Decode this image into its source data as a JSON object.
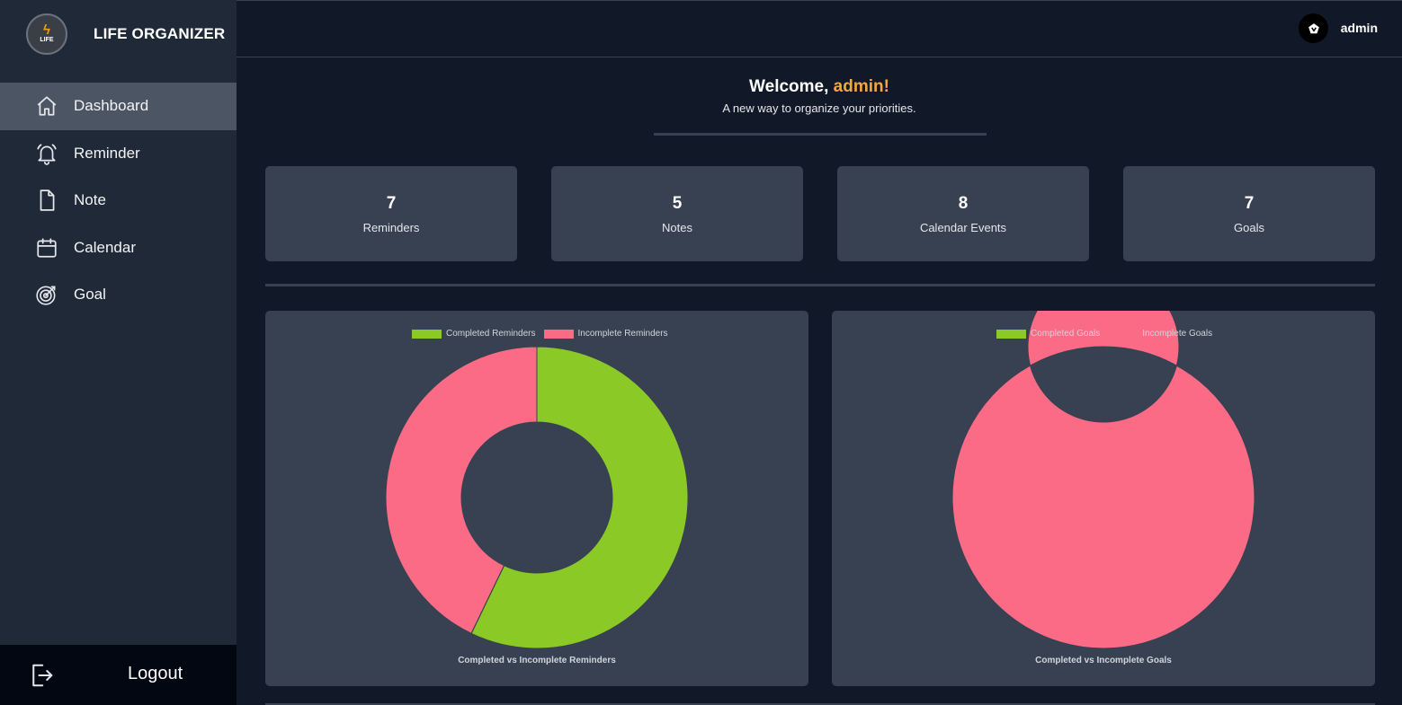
{
  "app": {
    "title": "LIFE ORGANIZER",
    "logo_text": "LIFE"
  },
  "sidebar": {
    "items": [
      {
        "label": "Dashboard",
        "icon": "home-icon",
        "active": true
      },
      {
        "label": "Reminder",
        "icon": "bell-icon"
      },
      {
        "label": "Note",
        "icon": "file-icon"
      },
      {
        "label": "Calendar",
        "icon": "calendar-icon"
      },
      {
        "label": "Goal",
        "icon": "target-icon"
      }
    ],
    "logout_label": "Logout"
  },
  "header": {
    "username": "admin"
  },
  "welcome": {
    "prefix": "Welcome,",
    "name": "admin!",
    "subtitle": "A new way to organize your priorities."
  },
  "stats": [
    {
      "value": "7",
      "label": "Reminders"
    },
    {
      "value": "5",
      "label": "Notes"
    },
    {
      "value": "8",
      "label": "Calendar Events"
    },
    {
      "value": "7",
      "label": "Goals"
    }
  ],
  "colors": {
    "completed": "#8bc926",
    "incomplete": "#fb6b85",
    "accent": "#f4a641"
  },
  "chart_data": [
    {
      "type": "pie",
      "title": "Completed vs Incomplete Reminders",
      "categories": [
        "Completed Reminders",
        "Incomplete Reminders"
      ],
      "values": [
        4,
        3
      ],
      "colors": [
        "#8bc926",
        "#fb6b85"
      ],
      "legend": "top"
    },
    {
      "type": "pie",
      "title": "Completed vs Incomplete Goals",
      "categories": [
        "Completed Goals",
        "Incomplete Goals"
      ],
      "values": [
        0,
        7
      ],
      "colors": [
        "#8bc926",
        "#fb6b85"
      ],
      "legend": "top"
    }
  ]
}
